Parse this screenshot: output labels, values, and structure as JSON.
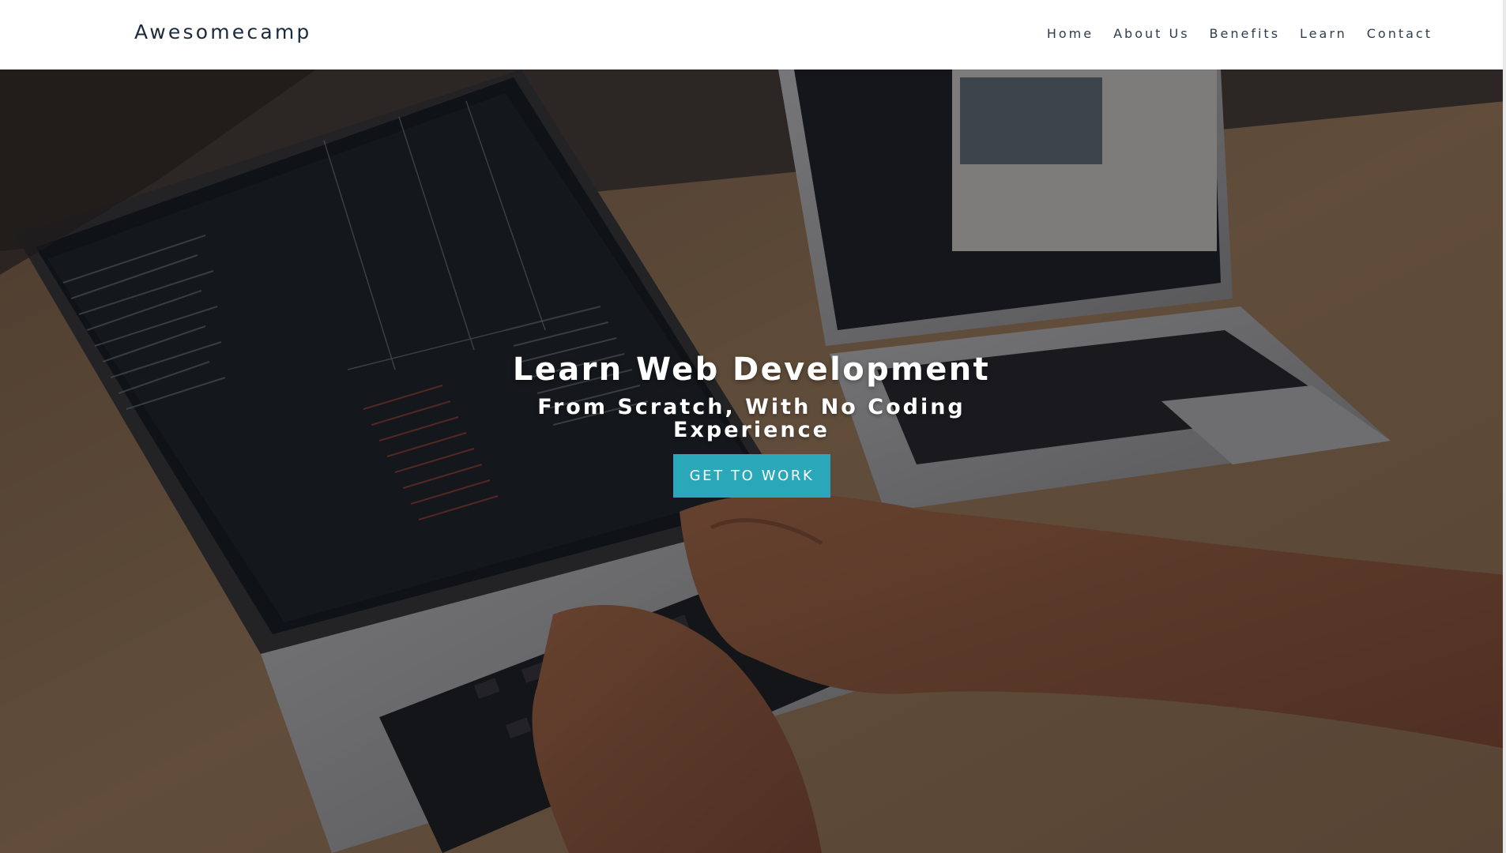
{
  "header": {
    "brand": "Awesomecamp",
    "nav": [
      "Home",
      "About Us",
      "Benefits",
      "Learn",
      "Contact"
    ]
  },
  "hero": {
    "title": "Learn Web Development",
    "subtitle": "From Scratch, With No Coding Experience",
    "cta_label": "GET TO WORK",
    "image_subject": "hands typing on a laptop showing terminal code, second laptop in background on wooden desk"
  },
  "colors": {
    "brand_text": "#1c2b3c",
    "nav_text": "#2f3d4c",
    "cta_background": "#2aa7b8",
    "hero_text": "#ffffff"
  }
}
